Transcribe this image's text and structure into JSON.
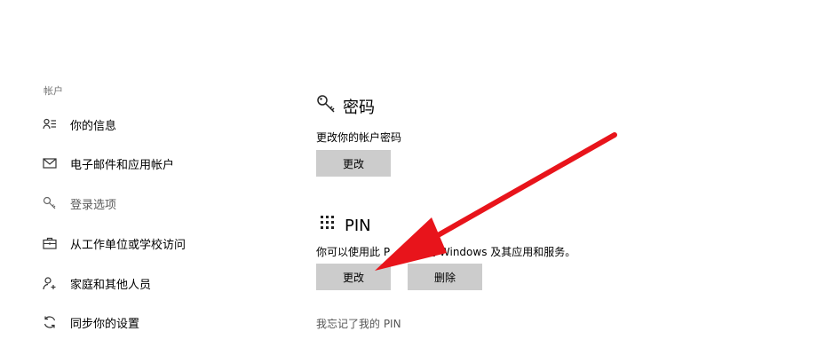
{
  "sidebar": {
    "section_label": "帐户",
    "items": [
      {
        "label": "你的信息",
        "icon": "person-list-icon"
      },
      {
        "label": "电子邮件和应用帐户",
        "icon": "mail-icon"
      },
      {
        "label": "登录选项",
        "icon": "key-icon"
      },
      {
        "label": "从工作单位或学校访问",
        "icon": "briefcase-icon"
      },
      {
        "label": "家庭和其他人员",
        "icon": "person-add-icon"
      },
      {
        "label": "同步你的设置",
        "icon": "sync-icon"
      }
    ]
  },
  "password": {
    "title": "密码",
    "description": "更改你的帐户密码",
    "change_label": "更改"
  },
  "pin": {
    "title": "PIN",
    "description": "你可以使用此 P",
    "description_tail": "到 Windows 及其应用和服务。",
    "change_label": "更改",
    "remove_label": "删除",
    "forgot_link": "我忘记了我的 PIN"
  },
  "colors": {
    "button_bg": "#cccccc",
    "arrow": "#e8141b",
    "muted_text": "#767676"
  }
}
